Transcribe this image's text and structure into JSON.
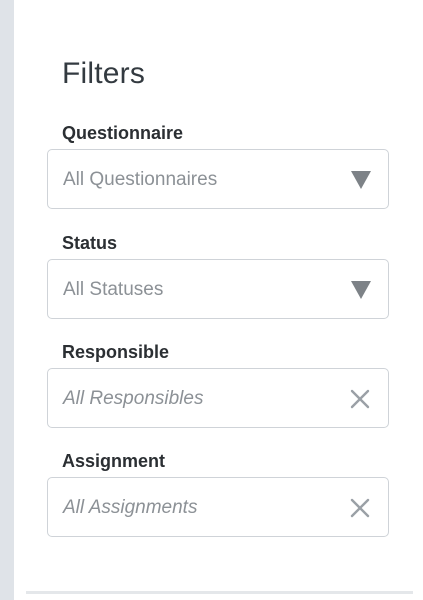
{
  "filters": {
    "title": "Filters",
    "questionnaire": {
      "label": "Questionnaire",
      "value": "All Questionnaires",
      "icon": "chevron-down-icon"
    },
    "status": {
      "label": "Status",
      "value": "All Statuses",
      "icon": "chevron-down-icon"
    },
    "responsible": {
      "label": "Responsible",
      "placeholder": "All Responsibles",
      "icon": "close-icon"
    },
    "assignment": {
      "label": "Assignment",
      "placeholder": "All Assignments",
      "icon": "close-icon"
    }
  },
  "colors": {
    "side_strip": "#dfe3e8",
    "text_dark": "#2b2f33",
    "text_muted": "#8c9196",
    "border": "#cfd3d8",
    "icon": "#7d8287"
  }
}
